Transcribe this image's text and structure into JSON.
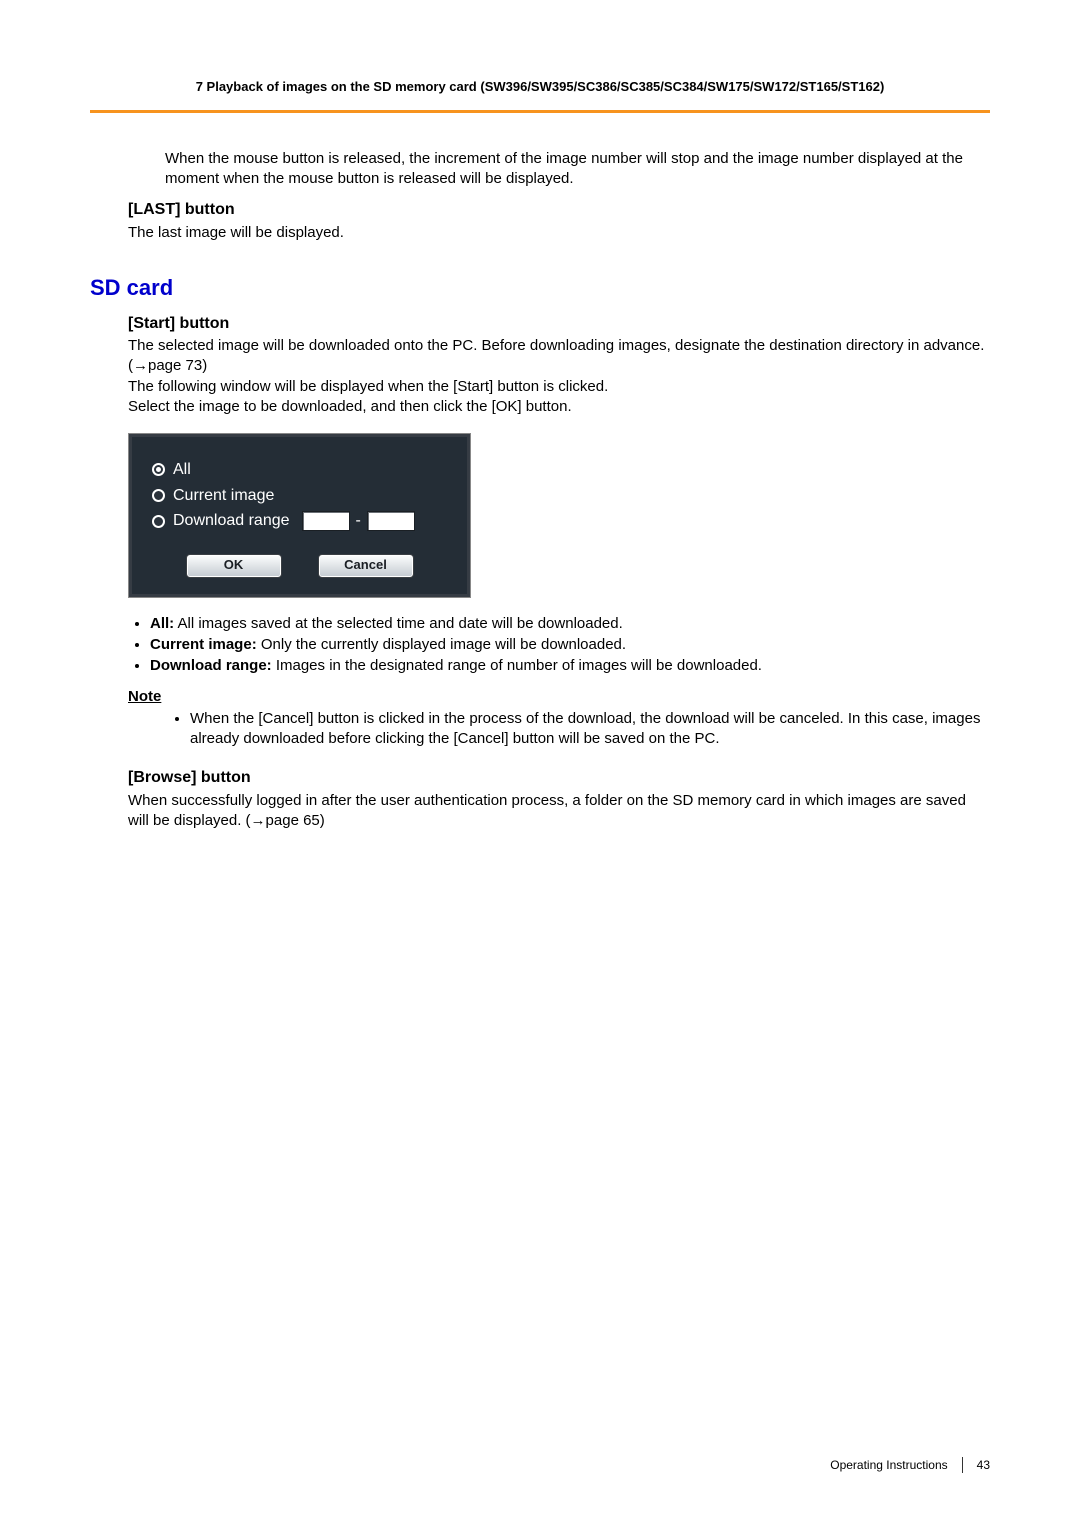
{
  "header": {
    "running_title": "7 Playback of images on the SD memory card (SW396/SW395/SC386/SC385/SC384/SW175/SW172/ST165/ST162)"
  },
  "continued_paragraph": "When the mouse button is released, the increment of the image number will stop and the image number displayed at the moment when the mouse button is released will be displayed.",
  "last_button": {
    "heading": "[LAST] button",
    "body": "The last image will be displayed."
  },
  "sd_card": {
    "title": "SD card",
    "start": {
      "heading": "[Start] button",
      "p1": "The selected image will be downloaded onto the PC. Before downloading images, designate the destination directory in advance. (→page 73)",
      "p2": "The following window will be displayed when the [Start] button is clicked.",
      "p3": "Select the image to be downloaded, and then click the [OK] button."
    },
    "dialog": {
      "options": {
        "all": "All",
        "current": "Current image",
        "range": "Download range",
        "range_sep": "-"
      },
      "ok": "OK",
      "cancel": "Cancel"
    },
    "bullets": {
      "all_label": "All:",
      "all_text": " All images saved at the selected time and date will be downloaded.",
      "cur_label": "Current image:",
      "cur_text": " Only the currently displayed image will be downloaded.",
      "rng_label": "Download range:",
      "rng_text": " Images in the designated range of number of images will be downloaded."
    },
    "note_label": "Note",
    "note_item": "When the [Cancel] button is clicked in the process of the download, the download will be canceled. In this case, images already downloaded before clicking the [Cancel] button will be saved on the PC.",
    "browse": {
      "heading": "[Browse] button",
      "body": "When successfully logged in after the user authentication process, a folder on the SD memory card in which images are saved will be displayed. (→page 65)"
    }
  },
  "footer": {
    "label": "Operating Instructions",
    "page": "43"
  }
}
